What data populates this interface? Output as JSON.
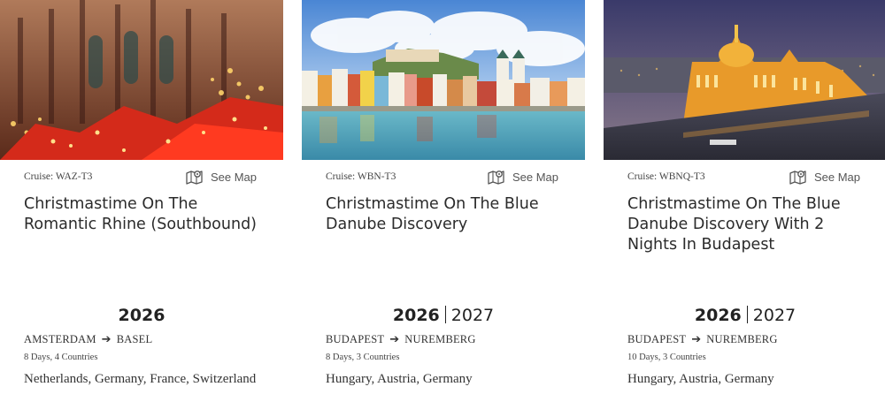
{
  "cards": [
    {
      "image_alt": "Cologne Cathedral above a Christmas market",
      "cruise_code": "Cruise: WAZ-T3",
      "see_map_label": "See Map",
      "title": "Christmastime On The Romantic Rhine (Southbound)",
      "year_main": "2026",
      "year_alt": "",
      "route_from": "AMSTERDAM",
      "route_to": "BASEL",
      "duration": "8 Days, 4 Countries",
      "countries": "Netherlands, Germany, France, Switzerland"
    },
    {
      "image_alt": "Colorful riverside town on the Danube",
      "cruise_code": "Cruise: WBN-T3",
      "see_map_label": "See Map",
      "title": "Christmastime On The Blue Danube Discovery",
      "year_main": "2026",
      "year_alt": "2027",
      "route_from": "BUDAPEST",
      "route_to": "NUREMBERG",
      "duration": "8 Days, 3 Countries",
      "countries": "Hungary, Austria, Germany"
    },
    {
      "image_alt": "Hungarian Parliament illuminated at dusk",
      "cruise_code": "Cruise: WBNQ-T3",
      "see_map_label": "See Map",
      "title": "Christmastime On The Blue Danube Discovery With 2 Nights In Budapest",
      "year_main": "2026",
      "year_alt": "2027",
      "route_from": "BUDAPEST",
      "route_to": "NUREMBERG",
      "duration": "10 Days, 3 Countries",
      "countries": "Hungary, Austria, Germany"
    }
  ]
}
